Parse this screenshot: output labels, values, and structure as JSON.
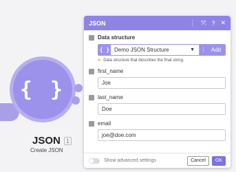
{
  "module": {
    "icon": "json-braces-icon",
    "braces": "{ }",
    "name": "JSON",
    "id_badge": "1",
    "subtitle": "Create JSON"
  },
  "panel": {
    "title": "JSON",
    "header_icons": [
      "more-vertical-icon",
      "expand-icon",
      "help-icon",
      "close-icon"
    ],
    "header_glyphs": {
      "more": "⋮",
      "expand": "⤧",
      "help": "?",
      "close": "✕"
    },
    "data_structure": {
      "label": "Data structure",
      "icon_text": "{ }",
      "selected": "Demo JSON Structure",
      "caret": "▼",
      "menu_glyph": "⋮",
      "add_label": "Add",
      "hint": "Data structure that describes the final string."
    },
    "fields": [
      {
        "label": "first_name",
        "value": "Joe"
      },
      {
        "label": "last_name",
        "value": "Doe"
      },
      {
        "label": "email",
        "value": "joe@doe.com"
      }
    ],
    "footer": {
      "advanced_label": "Show advanced settings",
      "cancel_label": "Cancel",
      "ok_label": "OK"
    }
  },
  "colors": {
    "accent": "#8f83e6",
    "module_fill": "#9d92eb",
    "ok_button": "#7e71e0",
    "background": "#f3f3f5"
  }
}
